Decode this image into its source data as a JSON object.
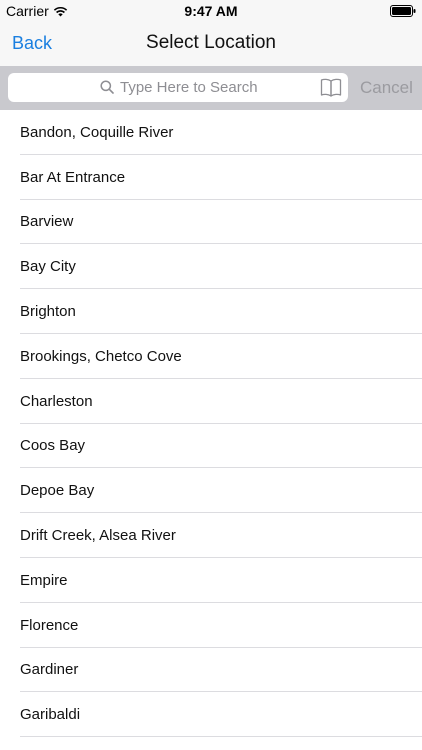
{
  "status_bar": {
    "carrier": "Carrier",
    "time": "9:47 AM",
    "icons": [
      "wifi-icon",
      "battery-icon"
    ]
  },
  "nav": {
    "back_label": "Back",
    "title": "Select Location",
    "accent_color": "#1a7fe0"
  },
  "search": {
    "placeholder": "Type Here to Search",
    "value": "",
    "cancel_label": "Cancel",
    "icons": [
      "search-icon",
      "bookmark-icon"
    ]
  },
  "locations": [
    "Bandon, Coquille River",
    "Bar At Entrance",
    "Barview",
    "Bay City",
    "Brighton",
    "Brookings, Chetco Cove",
    "Charleston",
    "Coos Bay",
    "Depoe Bay",
    "Drift Creek, Alsea River",
    "Empire",
    "Florence",
    "Gardiner",
    "Garibaldi"
  ]
}
